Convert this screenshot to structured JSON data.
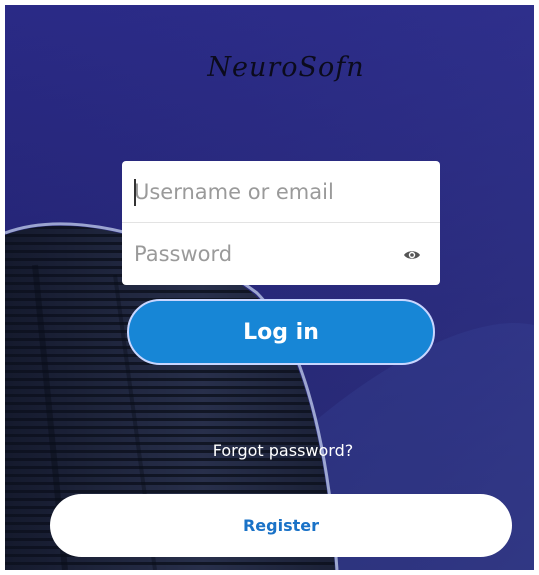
{
  "brand": {
    "logo_text": "NeuroSofn"
  },
  "login_form": {
    "username_placeholder": "Username or email",
    "username_value": "",
    "password_placeholder": "Password",
    "password_value": "",
    "password_toggle_icon": "eye-icon",
    "login_label": "Log in"
  },
  "links": {
    "forgot_password": "Forgot password?"
  },
  "register": {
    "label": "Register"
  },
  "colors": {
    "background": "#25257a",
    "primary_button": "#1786d6",
    "register_text": "#1a72c7"
  }
}
